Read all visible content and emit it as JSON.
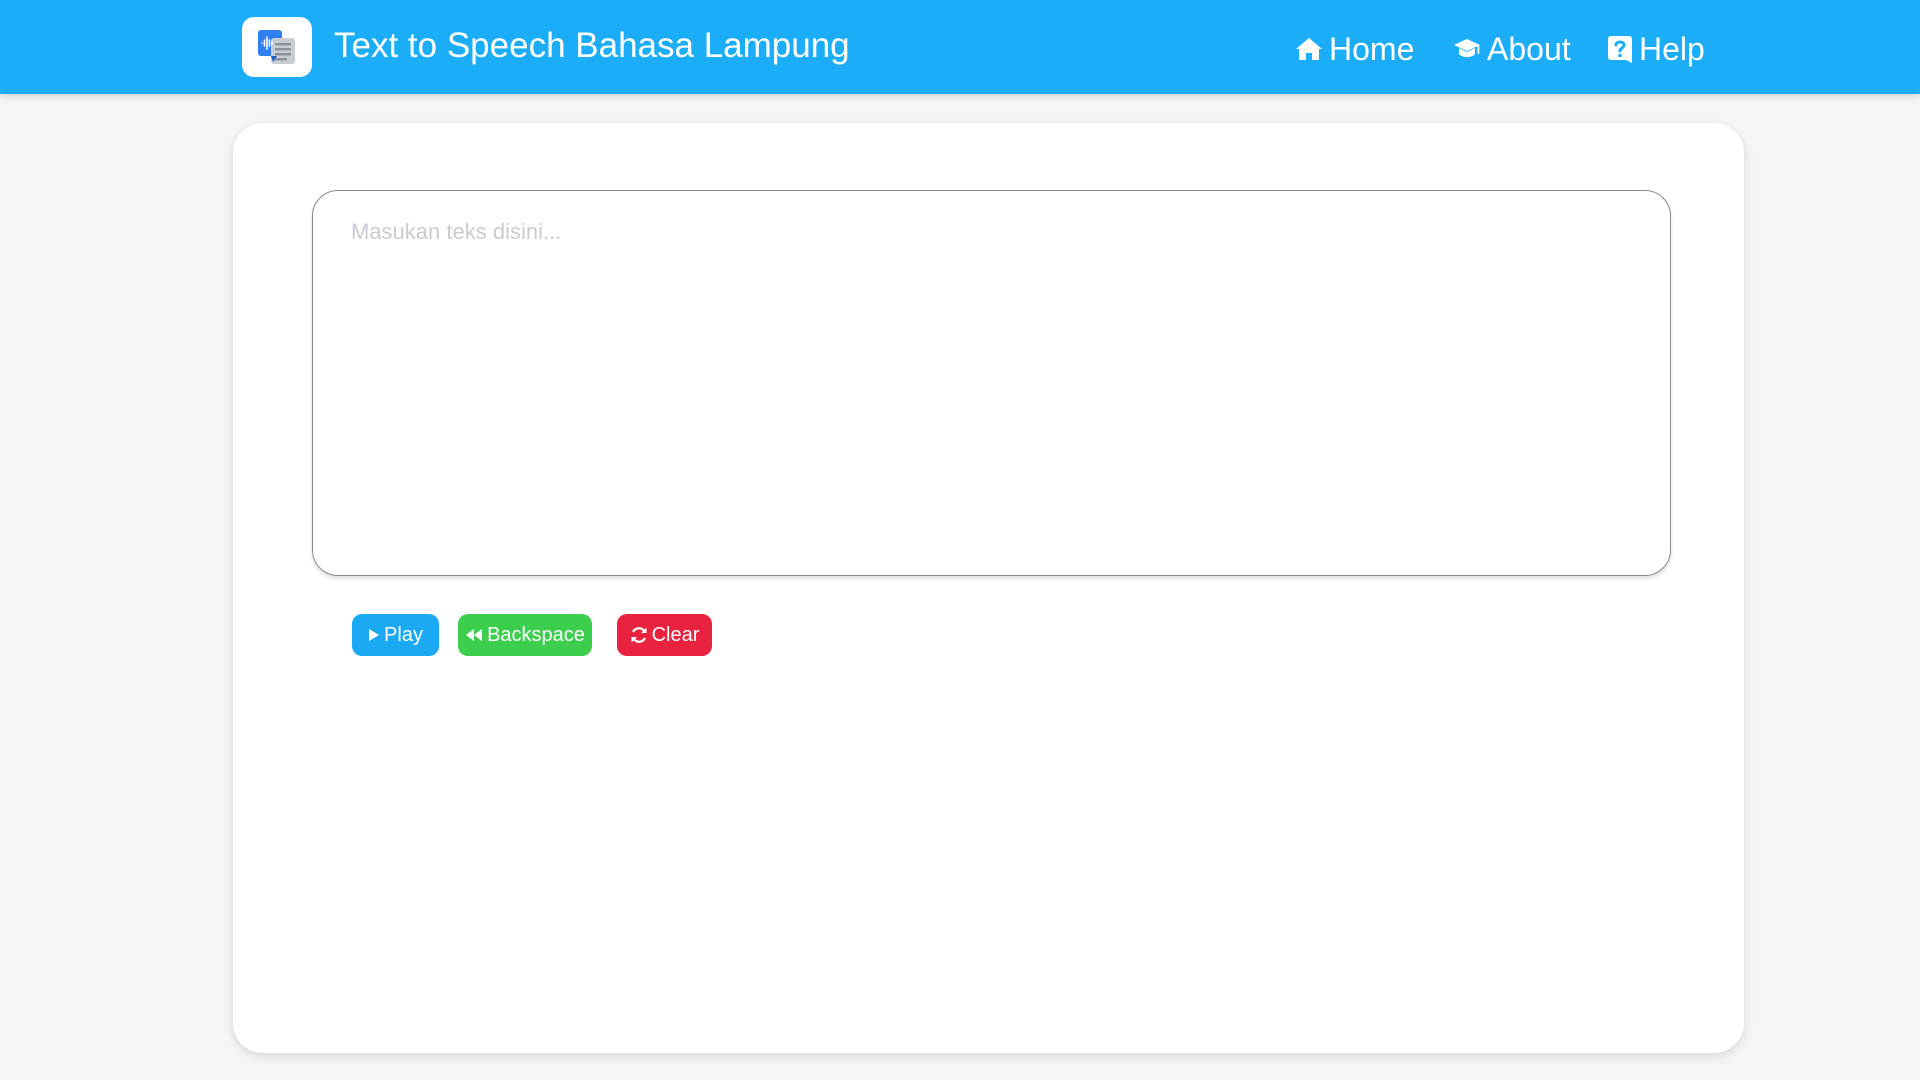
{
  "navbar": {
    "brand_title": "Text to Speech Bahasa Lampung",
    "logo_icon": "text-to-speech-logo-icon",
    "links": [
      {
        "label": "Home",
        "icon": "home-icon"
      },
      {
        "label": "About",
        "icon": "graduation-cap-icon"
      },
      {
        "label": "Help",
        "icon": "question-square-icon"
      }
    ]
  },
  "editor": {
    "value": "",
    "placeholder": "Masukan teks disini..."
  },
  "actions": {
    "play_label": "Play",
    "backspace_label": "Backspace",
    "clear_label": "Clear"
  },
  "colors": {
    "navbar": "#1cadf8",
    "play": "#1ca9f4",
    "backspace": "#3ccf4e",
    "clear": "#e9233f"
  }
}
